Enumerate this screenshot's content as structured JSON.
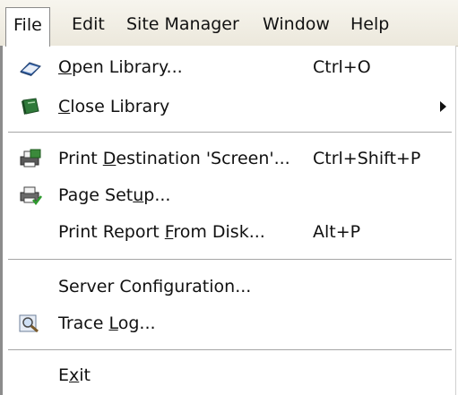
{
  "menubar": {
    "items": [
      {
        "label": "File"
      },
      {
        "label": "Edit"
      },
      {
        "label": "Site Manager"
      },
      {
        "label": "Window"
      },
      {
        "label": "Help"
      }
    ]
  },
  "file_menu": {
    "open_library": {
      "pre": "",
      "ul": "O",
      "post": "pen Library...",
      "shortcut": "Ctrl+O",
      "icon": "open-book-icon"
    },
    "close_library": {
      "pre": "",
      "ul": "C",
      "post": "lose Library",
      "icon": "closed-book-icon"
    },
    "print_destination": {
      "pre": "Print ",
      "ul": "D",
      "post": "estination 'Screen'...",
      "shortcut": "Ctrl+Shift+P",
      "icon": "printer-screen-icon"
    },
    "page_setup": {
      "pre": "Page Set",
      "ul": "u",
      "post": "p...",
      "icon": "page-setup-printer-icon"
    },
    "print_report": {
      "pre": "Print Report ",
      "ul": "F",
      "post": "rom Disk...",
      "shortcut": "Alt+P"
    },
    "server_config": {
      "pre": "Server Configuration...",
      "ul": "",
      "post": ""
    },
    "trace_log": {
      "pre": "Trace ",
      "ul": "L",
      "post": "og...",
      "icon": "magnifier-log-icon"
    },
    "exit": {
      "pre": "E",
      "ul": "x",
      "post": "it"
    }
  }
}
